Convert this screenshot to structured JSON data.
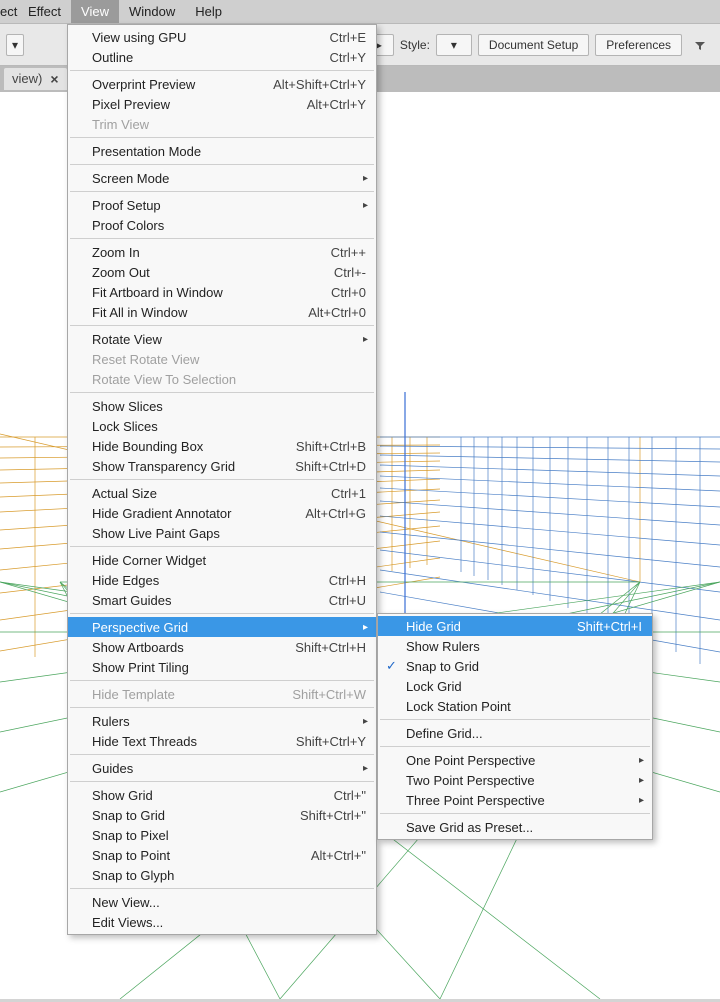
{
  "menubar": {
    "effect": "Effect",
    "view": "View",
    "window": "Window",
    "help": "Help"
  },
  "toolbar": {
    "style_label": "Style:",
    "doc_setup": "Document Setup",
    "preferences": "Preferences"
  },
  "tab": {
    "title": "view)"
  },
  "view_menu": [
    {
      "type": "item",
      "label": "View using GPU",
      "sc": "Ctrl+E"
    },
    {
      "type": "item",
      "label": "Outline",
      "sc": "Ctrl+Y"
    },
    {
      "type": "sep"
    },
    {
      "type": "item",
      "label": "Overprint Preview",
      "sc": "Alt+Shift+Ctrl+Y"
    },
    {
      "type": "item",
      "label": "Pixel Preview",
      "sc": "Alt+Ctrl+Y"
    },
    {
      "type": "item",
      "label": "Trim View",
      "disabled": true
    },
    {
      "type": "sep"
    },
    {
      "type": "item",
      "label": "Presentation Mode"
    },
    {
      "type": "sep"
    },
    {
      "type": "item",
      "label": "Screen Mode",
      "sub": true
    },
    {
      "type": "sep"
    },
    {
      "type": "item",
      "label": "Proof Setup",
      "sub": true
    },
    {
      "type": "item",
      "label": "Proof Colors"
    },
    {
      "type": "sep"
    },
    {
      "type": "item",
      "label": "Zoom In",
      "sc": "Ctrl++"
    },
    {
      "type": "item",
      "label": "Zoom Out",
      "sc": "Ctrl+-"
    },
    {
      "type": "item",
      "label": "Fit Artboard in Window",
      "sc": "Ctrl+0"
    },
    {
      "type": "item",
      "label": "Fit All in Window",
      "sc": "Alt+Ctrl+0"
    },
    {
      "type": "sep"
    },
    {
      "type": "item",
      "label": "Rotate View",
      "sub": true
    },
    {
      "type": "item",
      "label": "Reset Rotate View",
      "disabled": true
    },
    {
      "type": "item",
      "label": "Rotate View To Selection",
      "disabled": true
    },
    {
      "type": "sep"
    },
    {
      "type": "item",
      "label": "Show Slices"
    },
    {
      "type": "item",
      "label": "Lock Slices"
    },
    {
      "type": "item",
      "label": "Hide Bounding Box",
      "sc": "Shift+Ctrl+B"
    },
    {
      "type": "item",
      "label": "Show Transparency Grid",
      "sc": "Shift+Ctrl+D"
    },
    {
      "type": "sep"
    },
    {
      "type": "item",
      "label": "Actual Size",
      "sc": "Ctrl+1"
    },
    {
      "type": "item",
      "label": "Hide Gradient Annotator",
      "sc": "Alt+Ctrl+G"
    },
    {
      "type": "item",
      "label": "Show Live Paint Gaps"
    },
    {
      "type": "sep"
    },
    {
      "type": "item",
      "label": "Hide Corner Widget"
    },
    {
      "type": "item",
      "label": "Hide Edges",
      "sc": "Ctrl+H"
    },
    {
      "type": "item",
      "label": "Smart Guides",
      "sc": "Ctrl+U"
    },
    {
      "type": "sep"
    },
    {
      "type": "item",
      "label": "Perspective Grid",
      "sub": true,
      "hl": true
    },
    {
      "type": "item",
      "label": "Show Artboards",
      "sc": "Shift+Ctrl+H"
    },
    {
      "type": "item",
      "label": "Show Print Tiling"
    },
    {
      "type": "sep"
    },
    {
      "type": "item",
      "label": "Hide Template",
      "sc": "Shift+Ctrl+W",
      "disabled": true
    },
    {
      "type": "sep"
    },
    {
      "type": "item",
      "label": "Rulers",
      "sub": true
    },
    {
      "type": "item",
      "label": "Hide Text Threads",
      "sc": "Shift+Ctrl+Y"
    },
    {
      "type": "sep"
    },
    {
      "type": "item",
      "label": "Guides",
      "sub": true
    },
    {
      "type": "sep"
    },
    {
      "type": "item",
      "label": "Show Grid",
      "sc": "Ctrl+\""
    },
    {
      "type": "item",
      "label": "Snap to Grid",
      "sc": "Shift+Ctrl+\""
    },
    {
      "type": "item",
      "label": "Snap to Pixel"
    },
    {
      "type": "item",
      "label": "Snap to Point",
      "sc": "Alt+Ctrl+\""
    },
    {
      "type": "item",
      "label": "Snap to Glyph"
    },
    {
      "type": "sep"
    },
    {
      "type": "item",
      "label": "New View..."
    },
    {
      "type": "item",
      "label": "Edit Views..."
    }
  ],
  "perspective_submenu": [
    {
      "type": "item",
      "label": "Hide Grid",
      "sc": "Shift+Ctrl+I",
      "hl": true
    },
    {
      "type": "item",
      "label": "Show Rulers"
    },
    {
      "type": "item",
      "label": "Snap to Grid",
      "checked": true
    },
    {
      "type": "item",
      "label": "Lock Grid"
    },
    {
      "type": "item",
      "label": "Lock Station Point"
    },
    {
      "type": "sep"
    },
    {
      "type": "item",
      "label": "Define Grid..."
    },
    {
      "type": "sep"
    },
    {
      "type": "item",
      "label": "One Point Perspective",
      "sub": true
    },
    {
      "type": "item",
      "label": "Two Point Perspective",
      "sub": true
    },
    {
      "type": "item",
      "label": "Three Point Perspective",
      "sub": true
    },
    {
      "type": "sep"
    },
    {
      "type": "item",
      "label": "Save Grid as Preset..."
    }
  ]
}
